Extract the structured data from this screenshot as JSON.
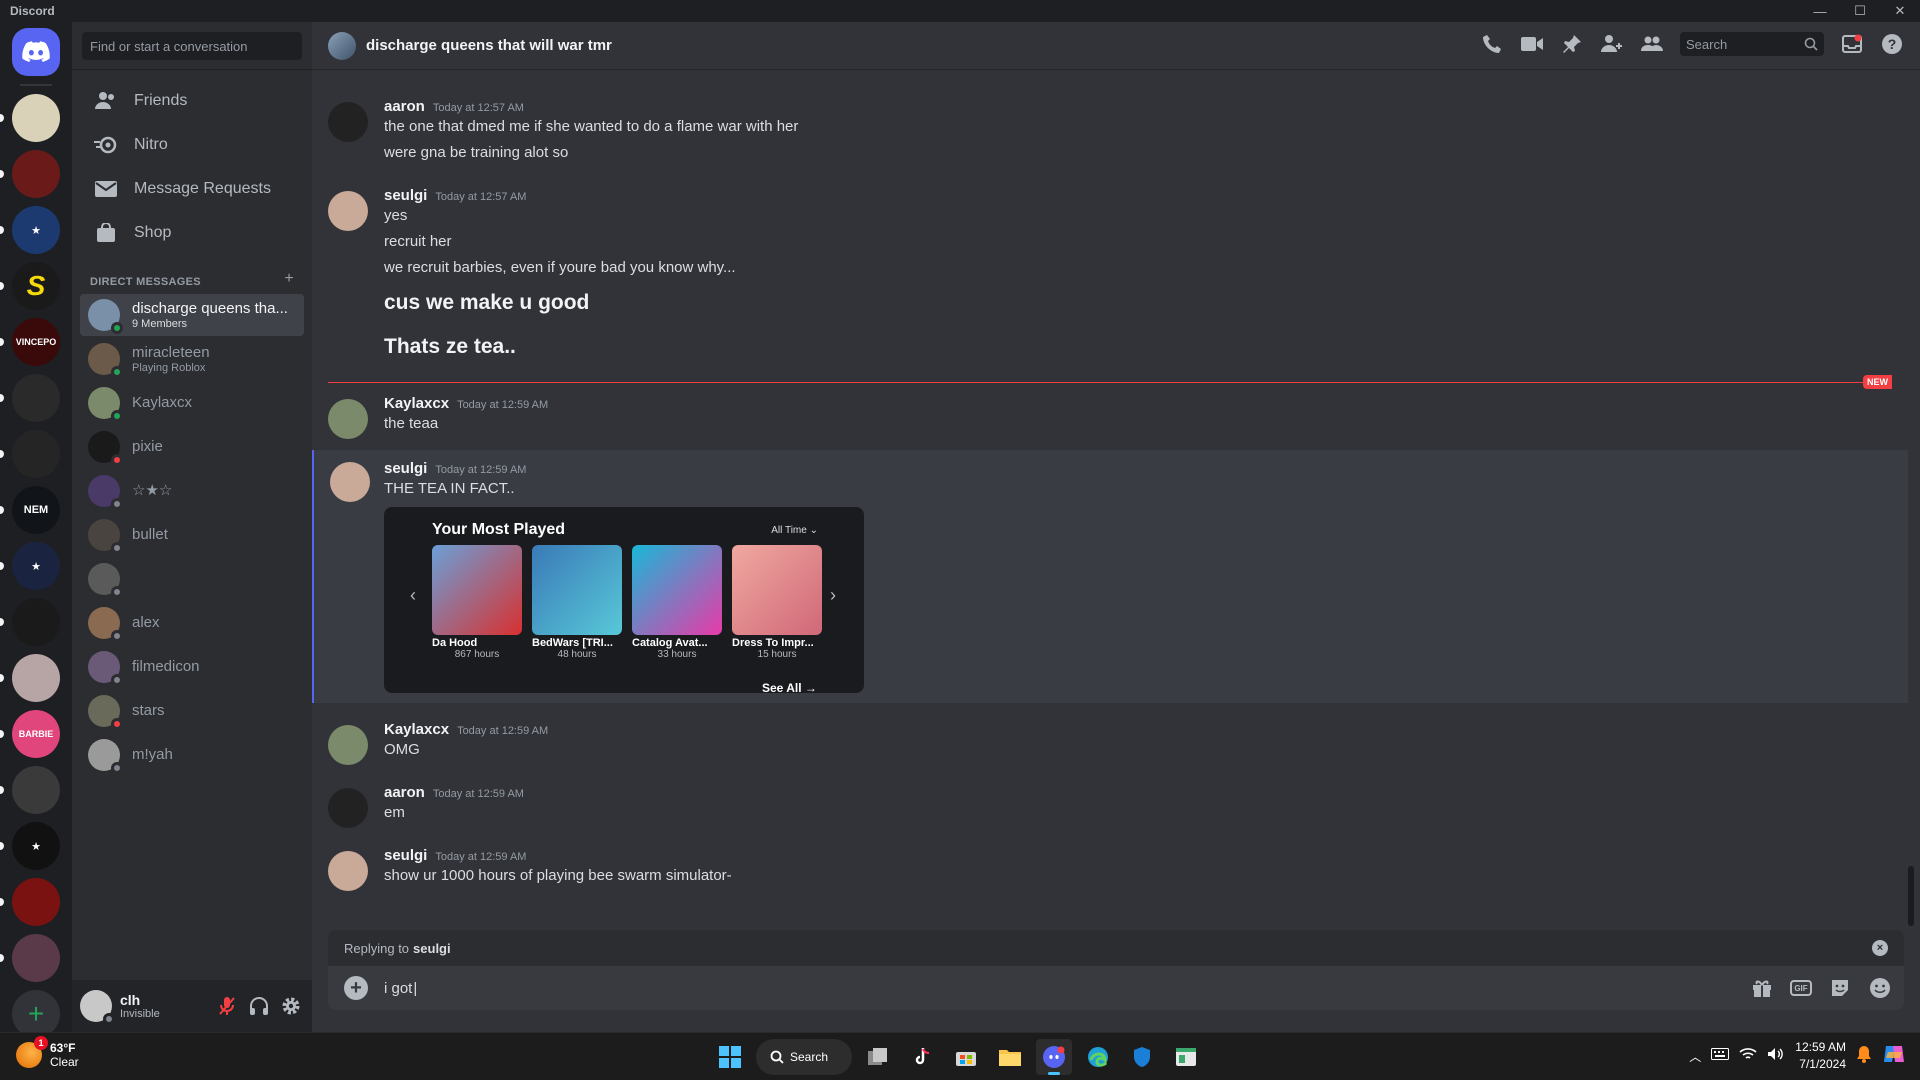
{
  "app": {
    "title": "Discord"
  },
  "window_controls": {
    "minimize": "—",
    "maximize": "☐",
    "close": "✕"
  },
  "servers": [
    {
      "name": "server-1",
      "color": "#d9d2b8",
      "label": ""
    },
    {
      "name": "server-2",
      "color": "#6b1a1a",
      "label": ""
    },
    {
      "name": "server-3",
      "color": "#1d3a70",
      "label": "★"
    },
    {
      "name": "server-4",
      "color": "#1a1a1a",
      "label": "S"
    },
    {
      "name": "server-5",
      "color": "#3a0a0a",
      "label": "VINCEPO"
    },
    {
      "name": "server-6",
      "color": "#2a2a2a",
      "label": ""
    },
    {
      "name": "server-7",
      "color": "#252525",
      "label": ""
    },
    {
      "name": "server-8",
      "color": "#111418",
      "label": "NEM"
    },
    {
      "name": "server-9",
      "color": "#1a2340",
      "label": "★"
    },
    {
      "name": "server-10",
      "color": "#1a1a1a",
      "label": ""
    },
    {
      "name": "server-11",
      "color": "#b7a4a4",
      "label": ""
    },
    {
      "name": "server-12",
      "color": "#e0457b",
      "label": "BARBIE"
    },
    {
      "name": "server-13",
      "color": "#3a3a3a",
      "label": ""
    },
    {
      "name": "server-14",
      "color": "#111111",
      "label": "★"
    },
    {
      "name": "server-15",
      "color": "#7a1212",
      "label": ""
    },
    {
      "name": "server-16",
      "color": "#5a3a48",
      "label": ""
    }
  ],
  "sidebar": {
    "search_placeholder": "Find or start a conversation",
    "nav": [
      {
        "label": "Friends",
        "icon": "friends-icon"
      },
      {
        "label": "Nitro",
        "icon": "nitro-icon"
      },
      {
        "label": "Message Requests",
        "icon": "mail-icon"
      },
      {
        "label": "Shop",
        "icon": "shop-icon"
      }
    ],
    "dm_header": "DIRECT MESSAGES",
    "dm_add": "+",
    "dms": [
      {
        "name": "discharge queens tha...",
        "sub": "9 Members",
        "status": "online",
        "color": "#7a90a8",
        "active": true
      },
      {
        "name": "miracleteen",
        "sub": "Playing Roblox",
        "status": "online",
        "color": "#6b5a4a"
      },
      {
        "name": "Kaylaxcx",
        "sub": "",
        "status": "online",
        "color": "#7b8a6b"
      },
      {
        "name": "pixie",
        "sub": "",
        "status": "dnd",
        "color": "#1a1a1a"
      },
      {
        "name": "☆★☆",
        "sub": "",
        "status": "offline",
        "color": "#4a3a68"
      },
      {
        "name": "bullet",
        "sub": "",
        "status": "offline",
        "color": "#4a4440"
      },
      {
        "name": "",
        "sub": "",
        "status": "offline",
        "color": "#5a5a5a"
      },
      {
        "name": "alex",
        "sub": "",
        "status": "offline",
        "color": "#8a6a50"
      },
      {
        "name": "filmedicon",
        "sub": "",
        "status": "offline",
        "color": "#6a5a78"
      },
      {
        "name": "stars",
        "sub": "",
        "status": "dnd",
        "color": "#6a6a5a"
      },
      {
        "name": "m!yah",
        "sub": "",
        "status": "offline",
        "color": "#9a9a9a"
      }
    ]
  },
  "user_panel": {
    "name": "clh",
    "status": "Invisible"
  },
  "channel": {
    "name": "discharge queens that will war tmr",
    "search_placeholder": "Search"
  },
  "messages": [
    {
      "author": "aaron",
      "time": "Today at 12:57 AM",
      "color": "#222222",
      "lines": [
        "the one that dmed me if she wanted to do a flame war with her",
        "were gna be training alot so"
      ],
      "big": []
    },
    {
      "author": "seulgi",
      "time": "Today at 12:57 AM",
      "color": "#c9aa98",
      "lines": [
        "yes",
        "recruit her",
        "we recruit barbies, even if youre bad you know why..."
      ],
      "big": [
        "cus we make u good",
        "Thats ze tea.."
      ]
    },
    {
      "author": "Kaylaxcx",
      "time": "Today at 12:59 AM",
      "color": "#7b8a6b",
      "lines": [
        "the teaa"
      ],
      "big": []
    },
    {
      "author": "seulgi",
      "time": "Today at 12:59 AM",
      "color": "#c9aa98",
      "lines": [
        "THE TEA IN FACT.."
      ],
      "big": []
    },
    {
      "author": "Kaylaxcx",
      "time": "Today at 12:59 AM",
      "color": "#7b8a6b",
      "lines": [
        "OMG"
      ],
      "big": []
    },
    {
      "author": "aaron",
      "time": "Today at 12:59 AM",
      "color": "#222222",
      "lines": [
        "em"
      ],
      "big": []
    },
    {
      "author": "seulgi",
      "time": "Today at 12:59 AM",
      "color": "#c9aa98",
      "lines": [
        "show ur 1000 hours of playing bee swarm simulator-"
      ],
      "big": []
    }
  ],
  "new_badge": "NEW",
  "embed": {
    "title": "Your Most Played",
    "filter": "All Time",
    "see_all": "See All",
    "games": [
      {
        "name": "Da Hood",
        "hours": "867 hours",
        "colors": [
          "#6aa0d8",
          "#d83030"
        ]
      },
      {
        "name": "BedWars [TRI...",
        "hours": "48 hours",
        "colors": [
          "#3a7ab8",
          "#58c8d8"
        ]
      },
      {
        "name": "Catalog Avat...",
        "hours": "33 hours",
        "colors": [
          "#18b8d8",
          "#e83aa8"
        ]
      },
      {
        "name": "Dress To Impr...",
        "hours": "15 hours",
        "colors": [
          "#f0a8a0",
          "#d06878"
        ]
      }
    ]
  },
  "reply": {
    "prefix": "Replying to",
    "user": "seulgi"
  },
  "composer": {
    "value": "i got"
  },
  "taskbar": {
    "temp": "63°F",
    "condition": "Clear",
    "weather_badge": "1",
    "search": "Search",
    "time": "12:59 AM",
    "date": "7/1/2024"
  }
}
